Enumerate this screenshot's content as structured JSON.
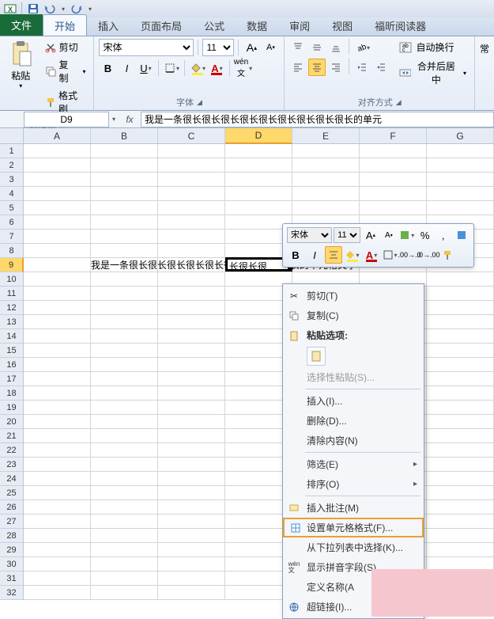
{
  "qat": {
    "save_icon": "save-icon",
    "undo_icon": "undo-icon",
    "redo_icon": "redo-icon"
  },
  "tabs": {
    "file": "文件",
    "home": "开始",
    "insert": "插入",
    "page_layout": "页面布局",
    "formulas": "公式",
    "data": "数据",
    "review": "审阅",
    "view": "视图",
    "foxit": "福昕阅读器"
  },
  "ribbon": {
    "clipboard": {
      "label": "剪贴板",
      "paste": "粘贴",
      "cut": "剪切",
      "copy": "复制",
      "format_painter": "格式刷"
    },
    "font": {
      "label": "字体",
      "name": "宋体",
      "size": "11"
    },
    "alignment": {
      "label": "对齐方式",
      "wrap": "自动换行",
      "merge_center": "合并后居中"
    },
    "right_hint": "常"
  },
  "formula_bar": {
    "cell_ref": "D9",
    "content": "我是一条很长很长很长很长很长很长很长很长很长的单元"
  },
  "columns": [
    "A",
    "B",
    "C",
    "D",
    "E",
    "F",
    "G"
  ],
  "rows": [
    "1",
    "2",
    "3",
    "4",
    "5",
    "6",
    "7",
    "8",
    "9",
    "10",
    "11",
    "12",
    "13",
    "14",
    "15",
    "16",
    "17",
    "18",
    "19",
    "20",
    "21",
    "22",
    "23",
    "24",
    "25",
    "26",
    "27",
    "28",
    "29",
    "30",
    "31",
    "32"
  ],
  "cell_text": "我是一条很长很长很长很长很长很长很长很长很长的单元格文字",
  "active_cell_display": "长很长很",
  "mini": {
    "font": "宋体",
    "size": "11",
    "percent": "%",
    "comma": ","
  },
  "context": {
    "cut": "剪切(T)",
    "copy": "复制(C)",
    "paste_options": "粘贴选项:",
    "paste_special": "选择性粘贴(S)...",
    "insert": "插入(I)...",
    "delete": "删除(D)...",
    "clear": "清除内容(N)",
    "filter": "筛选(E)",
    "sort": "排序(O)",
    "comment": "插入批注(M)",
    "format_cells": "设置单元格格式(F)...",
    "dropdown": "从下拉列表中选择(K)...",
    "phonetic": "显示拼音字段(S)",
    "define_name": "定义名称(A",
    "hyperlink": "超链接(I)..."
  }
}
